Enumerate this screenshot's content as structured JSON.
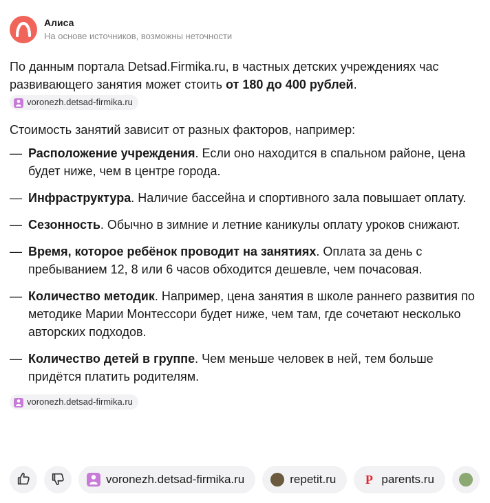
{
  "header": {
    "name": "Алиса",
    "subtitle": "На основе источников, возможны неточности"
  },
  "answer": {
    "intro_before": "По данным портала Detsad.Firmika.ru, в частных детских учреждениях час развивающего занятия может стоить ",
    "intro_bold": "от 180 до 400 рублей",
    "intro_after": ".",
    "source_chip_1": "voronezh.detsad-firmika.ru",
    "lead": "Стоимость занятий зависит от разных факторов, например:",
    "dash": "—",
    "factors": [
      {
        "bold": "Расположение учреждения",
        "text": ". Если оно находится в спальном районе, цена будет ниже, чем в центре города."
      },
      {
        "bold": "Инфраструктура",
        "text": ". Наличие бассейна и спортивного зала повышает оплату."
      },
      {
        "bold": "Сезонность",
        "text": ". Обычно в зимние и летние каникулы оплату уроков снижают."
      },
      {
        "bold": "Время, которое ребёнок проводит на занятиях",
        "text": ". Оплата за день с пребыванием 12,  8 или 6 часов обходится дешевле, чем почасовая."
      },
      {
        "bold": "Количество методик",
        "text": ". Например, цена занятия в школе раннего развития по методике Марии Монтессори будет ниже, чем там, где сочетают несколько авторских подходов."
      },
      {
        "bold": "Количество детей в группе",
        "text": ". Чем меньше человек в ней, тем больше придётся платить родителям."
      }
    ],
    "source_chip_2": "voronezh.detsad-firmika.ru"
  },
  "footer": {
    "like_icon": "thumbs-up-icon",
    "dislike_icon": "thumbs-down-icon",
    "sources": [
      {
        "label": "voronezh.detsad-firmika.ru",
        "icon": "detsad-favicon"
      },
      {
        "label": "repetit.ru",
        "icon": "repetit-favicon"
      },
      {
        "label": "parents.ru",
        "icon": "parents-favicon",
        "glyph": "P"
      }
    ]
  },
  "colors": {
    "avatar": "#f0645a",
    "chip_bg": "#f2f2f4",
    "detsad_favicon": "#c77ad8",
    "parents_favicon": "#e0262b"
  }
}
